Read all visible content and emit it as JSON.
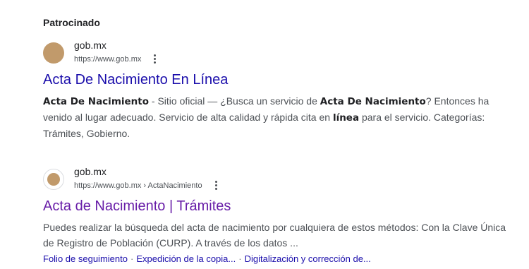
{
  "sponsored_label": "Patrocinado",
  "colors": {
    "link": "#1a0dab",
    "visited_link": "#681da8",
    "snippet": "#4d5156",
    "favicon": "#c19a6b"
  },
  "results": [
    {
      "site_name": "gob.mx",
      "url": "https://www.gob.mx",
      "menu_icon": "more-vert-icon",
      "title": "Acta De Nacimiento En Línea",
      "snippet_parts": {
        "b1": "Acta De Nacimiento",
        "t1": " - Sitio oficial — ¿Busca un servicio de ",
        "b2": "Acta De Nacimiento",
        "t2": "? Entonces ha venido al lugar adecuado. Servicio de alta calidad y rápida cita en ",
        "b3": "línea",
        "t3": " para el servicio. Categorías: Trámites, Gobierno."
      }
    },
    {
      "site_name": "gob.mx",
      "url": "https://www.gob.mx › ActaNacimiento",
      "menu_icon": "more-vert-icon",
      "title": "Acta de Nacimiento | Trámites",
      "snippet": "Puedes realizar la búsqueda del acta de nacimiento por cualquiera de estos métodos: Con la Clave Única de Registro de Población (CURP). A través de los datos ...",
      "sitelinks": [
        "Folio de seguimiento",
        "Expedición de la copia...",
        "Digitalización y corrección de..."
      ],
      "sitelink_separator": "·"
    }
  ]
}
